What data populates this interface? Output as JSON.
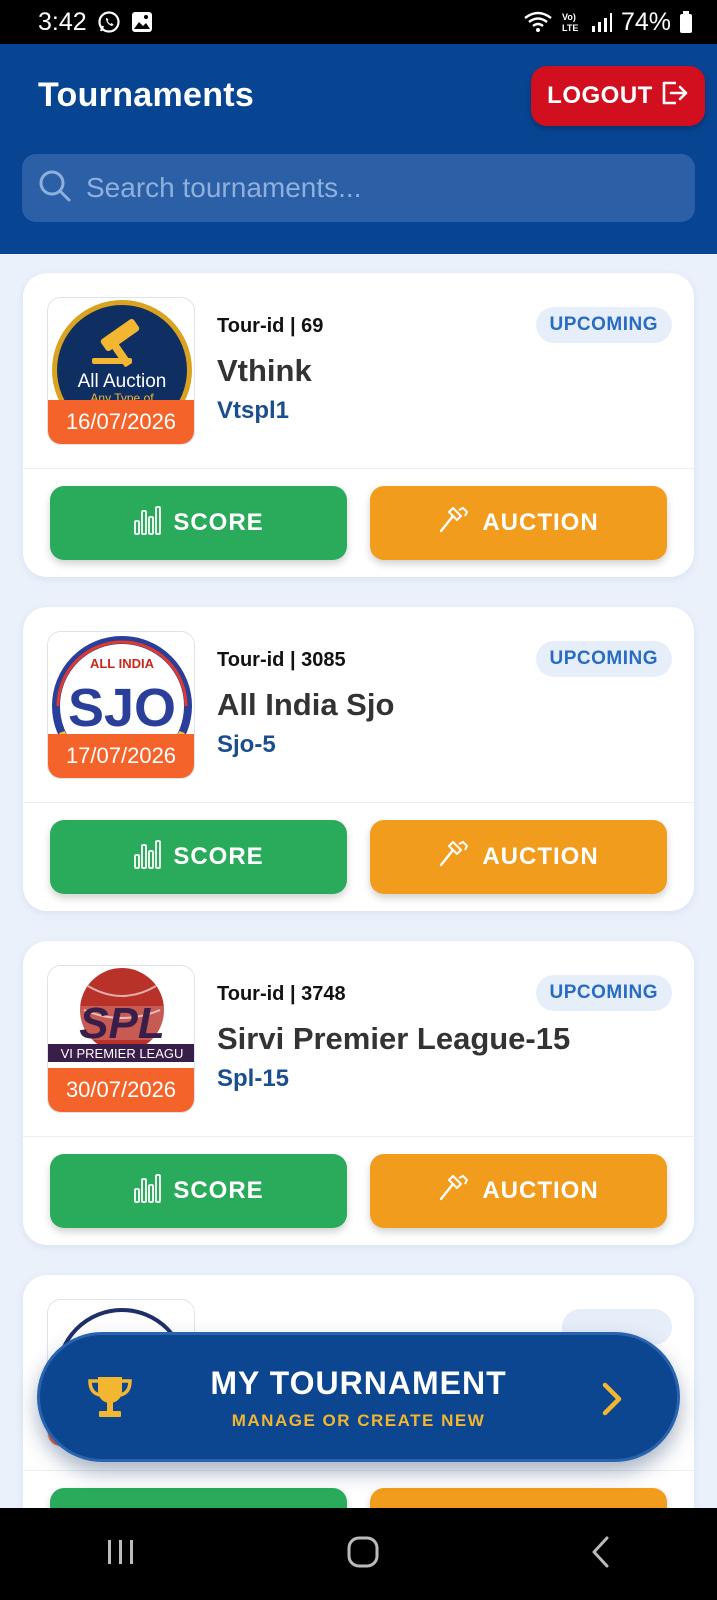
{
  "status_bar": {
    "time": "3:42",
    "battery": "74%",
    "network_label": "Vo) LTE"
  },
  "header": {
    "title": "Tournaments",
    "logout_label": "LOGOUT",
    "search_placeholder": "Search tournaments..."
  },
  "tournaments": [
    {
      "tour_id": "Tour-id | 69",
      "status": "UPCOMING",
      "name": "Vthink",
      "short": "Vtspl1",
      "date": "16/07/2026",
      "logo_text": "All Auction",
      "logo_sub": "Any Type of",
      "score_label": "SCORE",
      "auction_label": "AUCTION"
    },
    {
      "tour_id": "Tour-id | 3085",
      "status": "UPCOMING",
      "name": "All India Sjo",
      "short": "Sjo-5",
      "date": "17/07/2026",
      "logo_text": "SJO",
      "logo_top": "ALL INDIA",
      "score_label": "SCORE",
      "auction_label": "AUCTION"
    },
    {
      "tour_id": "Tour-id | 3748",
      "status": "UPCOMING",
      "name": "Sirvi Premier League-15",
      "short": "Spl-15",
      "date": "30/07/2026",
      "logo_text": "SPL",
      "logo_sub": "VI PREMIER LEAGU",
      "score_label": "SCORE",
      "auction_label": "AUCTION"
    }
  ],
  "my_tournament": {
    "title": "MY TOURNAMENT",
    "subtitle": "MANAGE OR CREATE NEW"
  },
  "colors": {
    "header_bg": "#074593",
    "logout_bg": "#d10f1f",
    "score_btn": "#2aab5c",
    "auction_btn": "#f29c1e",
    "date_badge": "#f4632a",
    "accent_gold": "#f2b630"
  }
}
